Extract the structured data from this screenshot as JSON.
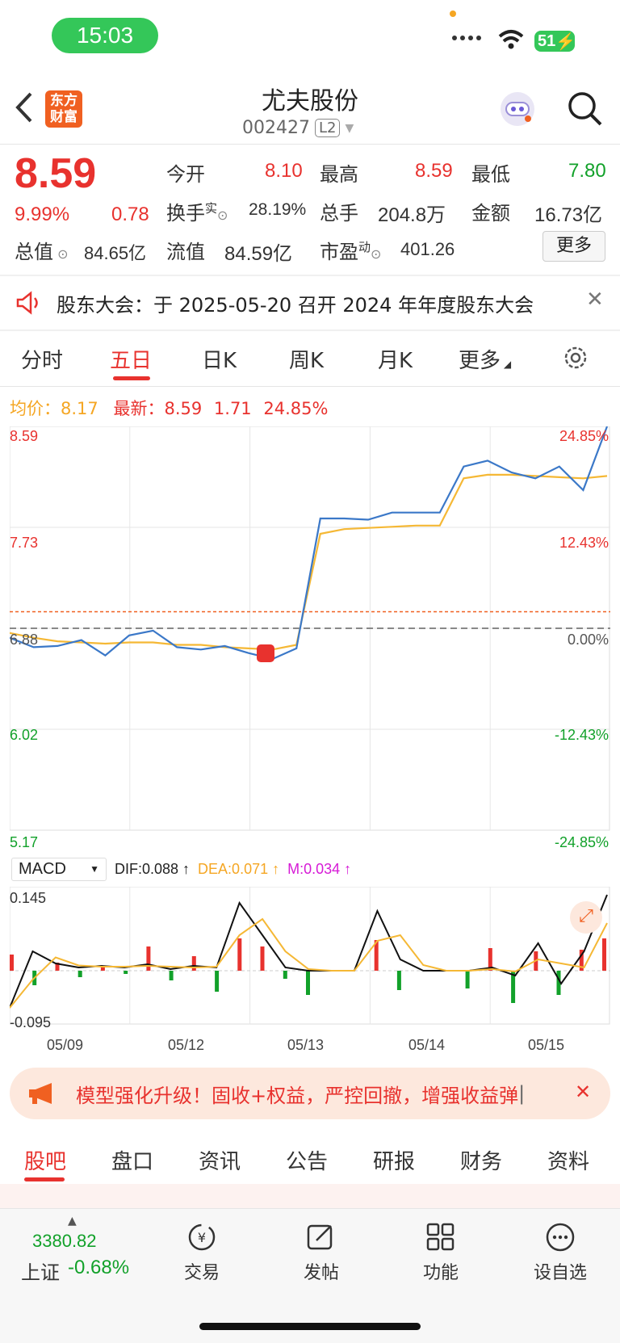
{
  "status": {
    "time": "15:03",
    "battery": "51"
  },
  "header": {
    "title": "尤夫股份",
    "code": "002427",
    "level": "L2",
    "logo_line1": "东方",
    "logo_line2": "财富"
  },
  "quote": {
    "price": "8.59",
    "change_pct": "9.99%",
    "change": "0.78",
    "open_label": "今开",
    "open": "8.10",
    "high_label": "最高",
    "high": "8.59",
    "low_label": "最低",
    "low": "7.80",
    "turnover_label": "换手",
    "turnover_sup": "实",
    "turnover": "28.19%",
    "volume_label": "总手",
    "volume": "204.8万",
    "amount_label": "金额",
    "amount": "16.73亿",
    "mcap_label": "总值",
    "mcap": "84.65亿",
    "float_label": "流值",
    "float": "84.59亿",
    "pe_label": "市盈",
    "pe_sup": "动",
    "pe": "401.26",
    "more": "更多"
  },
  "notice": {
    "text": "股东大会：于 2025-05-20 召开 2024 年年度股东大会"
  },
  "tabs": [
    "分时",
    "五日",
    "日K",
    "周K",
    "月K",
    "更多"
  ],
  "chart_info": {
    "avg_label": "均价：",
    "avg": "8.17",
    "latest_label": "最新：",
    "latest": "8.59",
    "change": "1.71",
    "change_pct": "24.85%"
  },
  "chart_data": {
    "type": "line",
    "title": "",
    "x_categories": [
      "05/09",
      "05/12",
      "05/13",
      "05/14",
      "05/15"
    ],
    "ylim": [
      5.17,
      8.59
    ],
    "y_ticks_left": [
      "8.59",
      "7.73",
      "6.88",
      "6.02",
      "5.17"
    ],
    "y_ticks_right": [
      "24.85%",
      "12.43%",
      "0.00%",
      "-12.43%",
      "-24.85%"
    ],
    "prev_close": 6.88,
    "series": [
      {
        "name": "",
        "values": [
          6.8,
          6.72,
          6.73,
          6.78,
          6.65,
          6.82,
          6.86,
          6.72,
          6.7,
          6.73,
          6.67,
          6.62,
          6.71,
          7.81,
          7.81,
          7.8,
          7.86,
          7.86,
          7.86,
          8.25,
          8.3,
          8.2,
          8.15,
          8.25,
          8.05,
          8.59
        ]
      },
      {
        "name": "",
        "values": [
          6.84,
          6.8,
          6.77,
          6.76,
          6.75,
          6.76,
          6.76,
          6.74,
          6.74,
          6.72,
          6.71,
          6.7,
          6.74,
          7.68,
          7.72,
          7.73,
          7.74,
          7.75,
          7.75,
          8.15,
          8.18,
          8.18,
          8.17,
          8.16,
          8.15,
          8.17
        ]
      }
    ],
    "macd": {
      "indicator": "MACD",
      "dif": "DIF:0.088 ↑",
      "dea": "DEA:0.071 ↑",
      "m": "M:0.034 ↑",
      "ytop": "0.145",
      "ybottom": "-0.095"
    }
  },
  "ad": {
    "text": "模型强化升级！固收+权益，严控回撤，增强收益弹"
  },
  "bottom_tabs": [
    "股吧",
    "盘口",
    "资讯",
    "公告",
    "研报",
    "财务",
    "资料"
  ],
  "nav": {
    "index_value": "3380.82",
    "index_name": "上证",
    "index_change": "-0.68%",
    "items": [
      "交易",
      "发帖",
      "功能",
      "设自选"
    ]
  },
  "colors": {
    "accent": "#e8322e",
    "down": "#12a12a",
    "price_line": "#3b78c8",
    "avg_line": "#f5b835"
  }
}
